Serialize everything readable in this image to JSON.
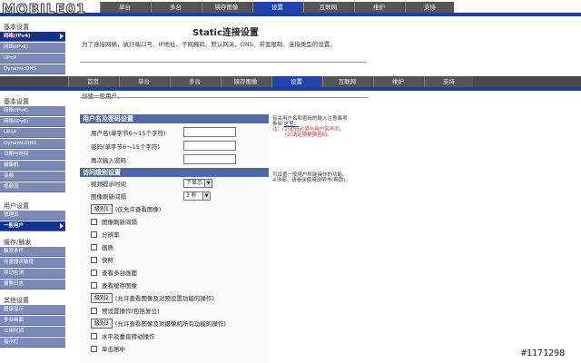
{
  "logo_text": "MOBILE01",
  "nav": {
    "tabs_top": [
      "单台",
      "多台",
      "镜存图像",
      "设置",
      "互联网",
      "维护",
      "支持"
    ],
    "tabs_bottom": [
      "首页",
      "单台",
      "多台",
      "镜存图像",
      "设置",
      "互联网",
      "维护",
      "支持"
    ],
    "selected": "设置"
  },
  "side_top": {
    "head": "基本设置",
    "items": [
      "网络(IPv4)",
      "网络(IPv6)",
      "UPnP",
      "DynamicDNS"
    ]
  },
  "side_bottom": {
    "groups": [
      {
        "head": "基本设置",
        "items": [
          "网络(IPv4)",
          "网络(IPv6)",
          "UPnP",
          "DynamicDNS",
          "日期与时间",
          "摄像机",
          "音频",
          "视频流"
        ]
      },
      {
        "head": "用户设置",
        "items": [
          "管理员",
          "一般用户"
        ]
      },
      {
        "head": "缓存/触发",
        "items": [
          "触发条件",
          "传感器灵敏度",
          "移动检测",
          "报警日志"
        ]
      },
      {
        "head": "其他设置",
        "items": [
          "图像显示",
          "多台画面",
          "公用时间",
          "指示灯"
        ]
      }
    ],
    "selected": "一般用户"
  },
  "static_title": "Static连接设置",
  "static_desc": "为了连接网络，执行端口号、IP地址、子网掩码、默认网关、DNS、带宽限制、连接类型的设置。",
  "cut_text": "创建一般用户。",
  "form": {
    "section1": "用户名及密码设置",
    "username_label": "用户名(单字节6～15个字符)",
    "password_label": "密码(单字节6～15个字符)",
    "confirm_label": "再次输入密码",
    "section2": "访问级别设置",
    "display_time_label": "视频提示时间",
    "display_time_value": "下显示",
    "refresh_label": "图像刷新间隔",
    "refresh_value": "3 秒",
    "level1_btn": "级别1",
    "level1_desc": "(仅允许查看图像)",
    "checks1": [
      "图像刷新间隔",
      "分辨率",
      "画质",
      "快照",
      "查看多台画面",
      "查看缓存图像"
    ],
    "level2_btn": "级别2",
    "level2_desc": "(允许查看图像及对预设置功能的操作)",
    "checks2": [
      "预设置操作(包括复位)"
    ],
    "level3_btn": "级别3",
    "level3_desc": "(允许查看图像及对摄像机所有功能的操作)",
    "checks3": [
      "水平及垂直转动操作",
      "单击居中"
    ]
  },
  "help1": {
    "line1": "有关用户名和密码的输入注意事项",
    "line2a": "参阅 ",
    "link": "这里。",
    "note_head": "注：",
    "note1": "(1)密码必须与用户名不同。",
    "note2": "(2)请定期更换密码。"
  },
  "help2": {
    "line1": "可设置一般用户所能操作的功能。",
    "line2": "※详细，请参阅使用说明书(帮助)。"
  },
  "watermark": "#1171298"
}
